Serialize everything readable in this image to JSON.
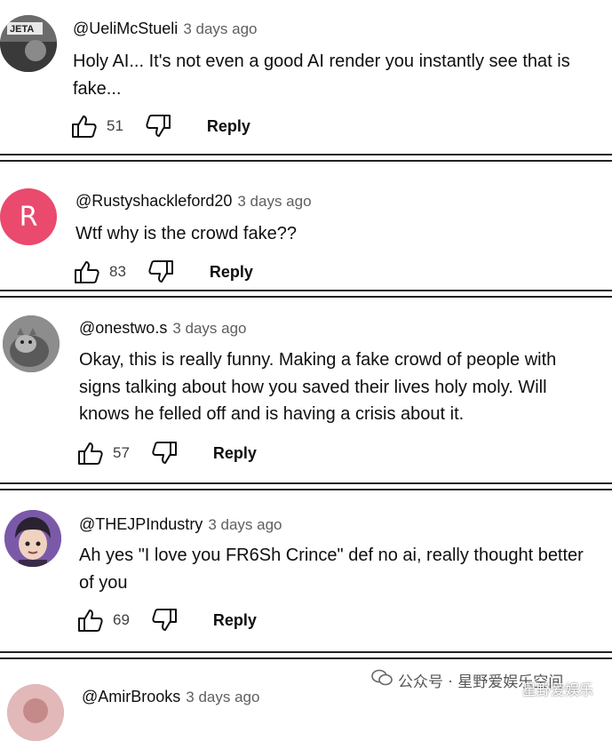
{
  "comments": [
    {
      "author": "@UeliMcStueli",
      "time": "3 days ago",
      "text": "Holy AI... It's not even a good AI render you instantly see that is fake...",
      "likes": "51",
      "reply_label": "Reply",
      "avatar_label": "JETA"
    },
    {
      "author": "@Rustyshackleford20",
      "time": "3 days ago",
      "text": "Wtf why is the crowd fake??",
      "likes": "83",
      "reply_label": "Reply",
      "avatar_letter": "R",
      "avatar_color": "#e94a6e"
    },
    {
      "author": "@onestwo.s",
      "time": "3 days ago",
      "text": "Okay, this is really funny. Making a fake crowd of people with signs talking about how you saved their lives holy moly. Will knows he felled off and is having a crisis about it.",
      "likes": "57",
      "reply_label": "Reply"
    },
    {
      "author": "@THEJPIndustry",
      "time": "3 days ago",
      "text": "Ah yes \"I love you FR6Sh Crince\" def no ai, really thought better of you",
      "likes": "69",
      "reply_label": "Reply"
    },
    {
      "author": "@AmirBrooks",
      "time": "3 days ago"
    }
  ],
  "watermark": {
    "text": "公众号 · 星野爱娱乐空间",
    "overlay": "星野爱娱乐"
  },
  "icons": {
    "like": "thumbs-up-icon",
    "dislike": "thumbs-down-icon",
    "watermark": "wechat-icon"
  }
}
